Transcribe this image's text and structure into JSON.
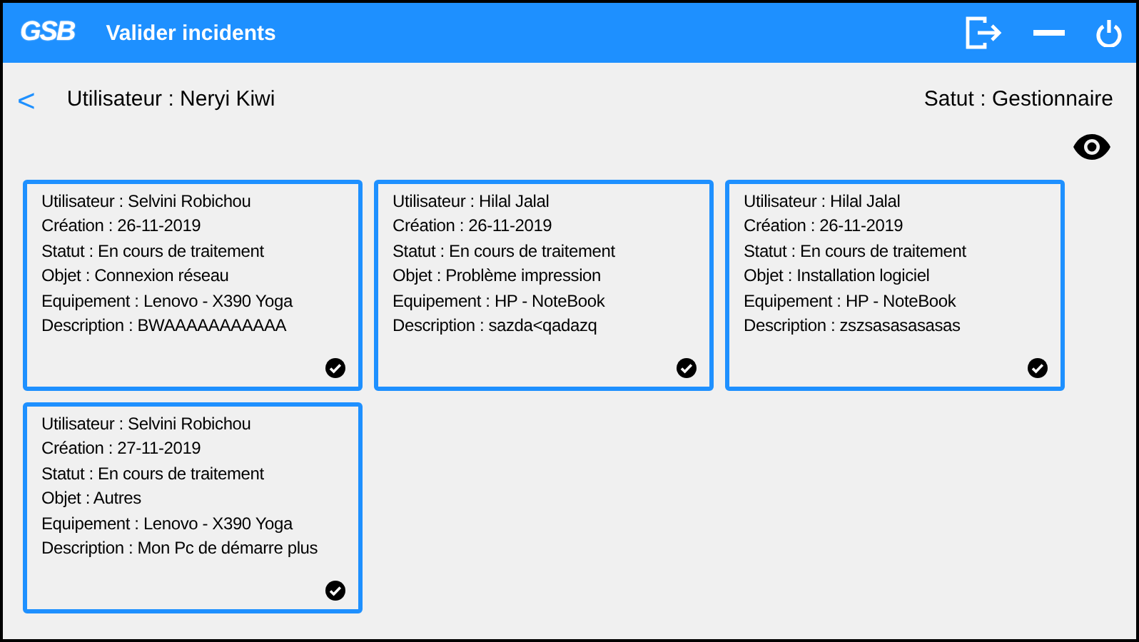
{
  "window": {
    "logo": "GSB",
    "title": "Valider incidents"
  },
  "user_bar": {
    "user": "Utilisateur : Neryi Kiwi",
    "back": "<",
    "status": "Satut : Gestionnaire"
  },
  "incidents": [
    {
      "lines": [
        "Utilisateur : Selvini Robichou",
        "Création : 26-11-2019",
        "Statut : En cours de traitement",
        "Objet : Connexion réseau",
        "Equipement : Lenovo - X390 Yoga",
        "Description : BWAAAAAAAAAAA"
      ]
    },
    {
      "lines": [
        "Utilisateur : Hilal Jalal",
        "Création : 26-11-2019",
        "Statut : En cours de traitement",
        "Objet : Problème impression",
        "Equipement : HP - NoteBook",
        "Description : sazda<qadazq"
      ]
    },
    {
      "lines": [
        "Utilisateur : Hilal Jalal",
        "Création : 26-11-2019",
        "Statut : En cours de traitement",
        "Objet : Installation logiciel",
        "Equipement : HP - NoteBook",
        "Description : zszsasasasasas"
      ]
    },
    {
      "lines": [
        "Utilisateur : Selvini Robichou",
        "Création : 27-11-2019",
        "Statut : En cours de traitement",
        "Objet : Autres",
        "Equipement : Lenovo - X390 Yoga",
        "Description : Mon Pc de démarre plus"
      ]
    }
  ]
}
